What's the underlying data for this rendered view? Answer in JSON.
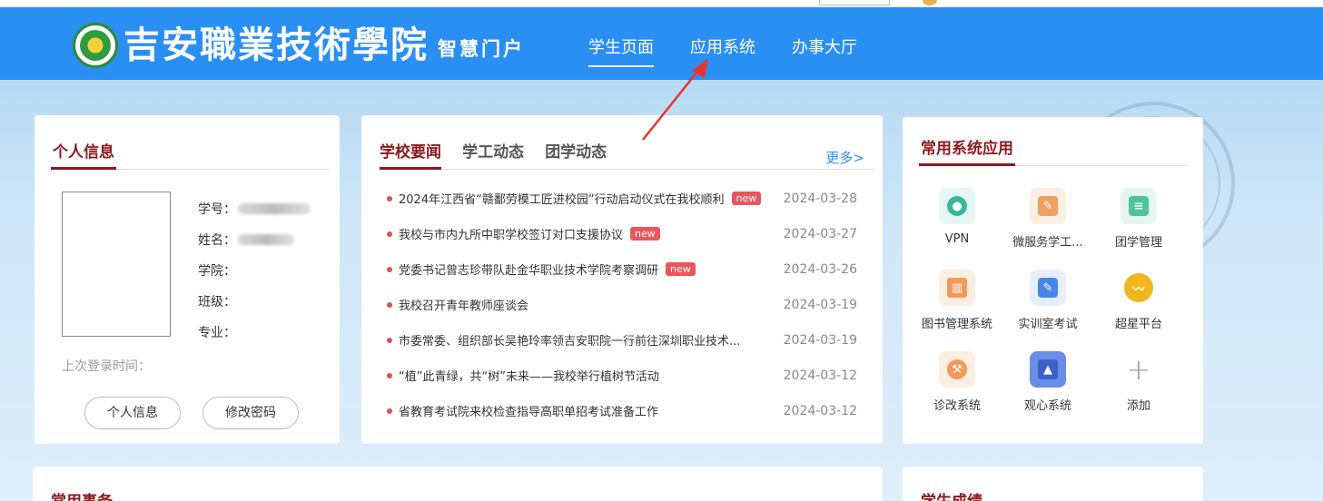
{
  "header": {
    "school_name": "吉安職業技術學院",
    "portal_name": "智慧门户",
    "nav": [
      {
        "label": "学生页面",
        "active": true
      },
      {
        "label": "应用系统",
        "active": false
      },
      {
        "label": "办事大厅",
        "active": false
      }
    ]
  },
  "personal": {
    "title": "个人信息",
    "fields": [
      {
        "label": "学号：",
        "value_blurred": true
      },
      {
        "label": "姓名：",
        "value_blurred": true
      },
      {
        "label": "学院：",
        "value_blurred": false
      },
      {
        "label": "班级：",
        "value_blurred": false
      },
      {
        "label": "专业：",
        "value_blurred": false
      }
    ],
    "last_login_label": "上次登录时间：",
    "buttons": {
      "info": "个人信息",
      "password": "修改密码"
    }
  },
  "news": {
    "tabs": [
      {
        "label": "学校要闻",
        "active": true
      },
      {
        "label": "学工动态",
        "active": false
      },
      {
        "label": "团学动态",
        "active": false
      }
    ],
    "more": "更多>",
    "new_badge": "new",
    "items": [
      {
        "title": "2024年江西省“赣鄱劳模工匠进校园”行动启动仪式在我校顺利",
        "date": "2024-03-28",
        "new": true
      },
      {
        "title": "我校与市内九所中职学校签订对口支援协议",
        "date": "2024-03-27",
        "new": true
      },
      {
        "title": "党委书记曾志珍带队赴金华职业技术学院考察调研",
        "date": "2024-03-26",
        "new": true
      },
      {
        "title": "我校召开青年教师座谈会",
        "date": "2024-03-19",
        "new": false
      },
      {
        "title": "市委常委、组织部长吴艳玲率领吉安职院一行前往深圳职业技术...",
        "date": "2024-03-19",
        "new": false
      },
      {
        "title": "“植”此青绿，共“树”未来——我校举行植树节活动",
        "date": "2024-03-12",
        "new": false
      },
      {
        "title": "省教育考试院来校检查指导高职单招考试准备工作",
        "date": "2024-03-12",
        "new": false
      }
    ]
  },
  "apps": {
    "title": "常用系统应用",
    "items": [
      {
        "label": "VPN",
        "icon": "globe-icon",
        "bg": "#e6f7f3",
        "fg": "#3ab89a"
      },
      {
        "label": "微服务学工...",
        "icon": "edit-doc-icon",
        "bg": "#fdeee2",
        "fg": "#f0a062"
      },
      {
        "label": "团学管理",
        "icon": "doc-clock-icon",
        "bg": "#e4f6ef",
        "fg": "#4cc59a"
      },
      {
        "label": "图书管理系统",
        "icon": "books-icon",
        "bg": "#fdeee2",
        "fg": "#f29a5c"
      },
      {
        "label": "实训室考试",
        "icon": "pen-paper-icon",
        "bg": "#e6effc",
        "fg": "#4a86e6"
      },
      {
        "label": "超星平台",
        "icon": "chaoxing-logo-icon",
        "bg": "#ffffff",
        "fg": "#f2b51c"
      },
      {
        "label": "诊改系统",
        "icon": "wrench-icon",
        "bg": "#fdeee2",
        "fg": "#f29a5c"
      },
      {
        "label": "观心系统",
        "icon": "graduation-cap-icon",
        "bg": "#6a8de8",
        "fg": "#3d5fc9"
      },
      {
        "label": "添加",
        "icon": "plus-icon",
        "bg": "#ffffff",
        "fg": "#999999"
      }
    ]
  },
  "bottom": {
    "common_title": "常用事务",
    "grades_title": "学生成绩"
  },
  "colors": {
    "header_blue": "#2a8ff2",
    "title_red": "#8b1a1a",
    "badge_red": "#e9575c",
    "arrow_red": "#e8362f"
  }
}
